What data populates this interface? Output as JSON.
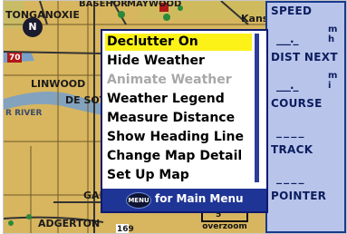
{
  "map": {
    "labels": {
      "town_1": "TONGANOXIE",
      "town_2": "BASEHOR",
      "town_3": "MAYWOOD",
      "town_4": "Kans",
      "road_70": "70",
      "town_5": "LINWOOD",
      "town_6": "DE SOT",
      "river": "R RIVER",
      "town_7": "GAR",
      "town_8": "ADGERTON",
      "road_169": "169",
      "north": "N"
    },
    "zoom": {
      "value": "5",
      "mode": "overzoom"
    }
  },
  "menu": {
    "items": [
      {
        "label": "Declutter On",
        "highlighted": true,
        "enabled": true
      },
      {
        "label": "Hide Weather",
        "highlighted": false,
        "enabled": true
      },
      {
        "label": "Animate Weather",
        "highlighted": false,
        "enabled": false
      },
      {
        "label": "Weather Legend",
        "highlighted": false,
        "enabled": true
      },
      {
        "label": "Measure Distance",
        "highlighted": false,
        "enabled": true
      },
      {
        "label": "Show Heading Line",
        "highlighted": false,
        "enabled": true
      },
      {
        "label": "Change Map Detail",
        "highlighted": false,
        "enabled": true
      },
      {
        "label": "Set Up Map",
        "highlighted": false,
        "enabled": true
      }
    ],
    "menu_button": "MENU",
    "footer_text": "for Main Menu"
  },
  "fields": [
    {
      "label": "SPEED",
      "value": "___._",
      "unit": "m h"
    },
    {
      "label": "DIST NEXT",
      "value": "___._",
      "unit": "m i"
    },
    {
      "label": "COURSE",
      "value": "_ _ _ _",
      "unit": ""
    },
    {
      "label": "TRACK",
      "value": "_ _ _ _",
      "unit": ""
    },
    {
      "label": "POINTER",
      "value": "",
      "unit": ""
    }
  ],
  "colors": {
    "map_bg": "#d8b65f",
    "panel_bg": "#193a8c",
    "field_bg": "#b8c4ea",
    "highlight": "#fcf218",
    "menu_footer": "#1f3595"
  }
}
